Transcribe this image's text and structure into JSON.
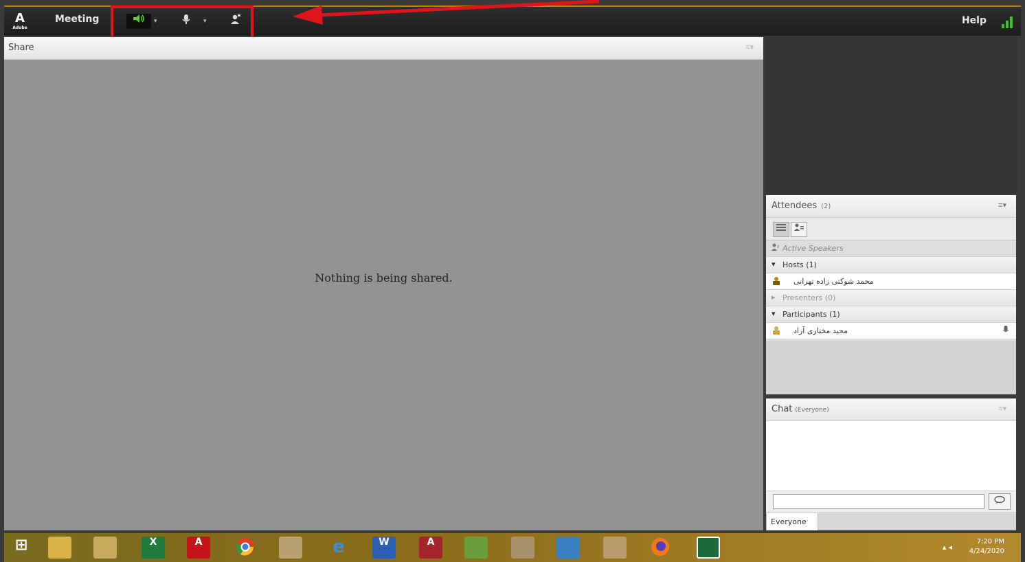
{
  "topbar": {
    "logo_text": "A",
    "logo_sub": "Adobe",
    "meeting_menu": "Meeting",
    "speaker_icon": "speaker-icon",
    "mic_icon": "microphone-icon",
    "camera_icon": "webcam-icon",
    "dropdown_glyph": "▾",
    "help": "Help",
    "highlight_color": "#e0141b"
  },
  "share_pod": {
    "title": "Share",
    "menu_glyph": "≡▾",
    "message": "Nothing is being shared."
  },
  "attendees_pod": {
    "title": "Attendees",
    "count": "(2)",
    "menu_glyph": "≡▾",
    "active_speakers": "Active Speakers",
    "hosts_label": "Hosts (1)",
    "host_name": "محمد شوکتی زاده تهرانی",
    "presenters_label": "Presenters (0)",
    "participants_label": "Participants (1)",
    "participant_name": "مجید مختاری آزاد"
  },
  "chat_pod": {
    "title": "Chat",
    "scope": "(Everyone)",
    "menu_glyph": "≡▾",
    "send_glyph": "💬",
    "tab_label": "Everyone"
  },
  "taskbar": {
    "start_glyph": "⊞",
    "time": "7:20 PM",
    "date": "4/24/2020",
    "tray_glyph": "▴ ◂"
  }
}
